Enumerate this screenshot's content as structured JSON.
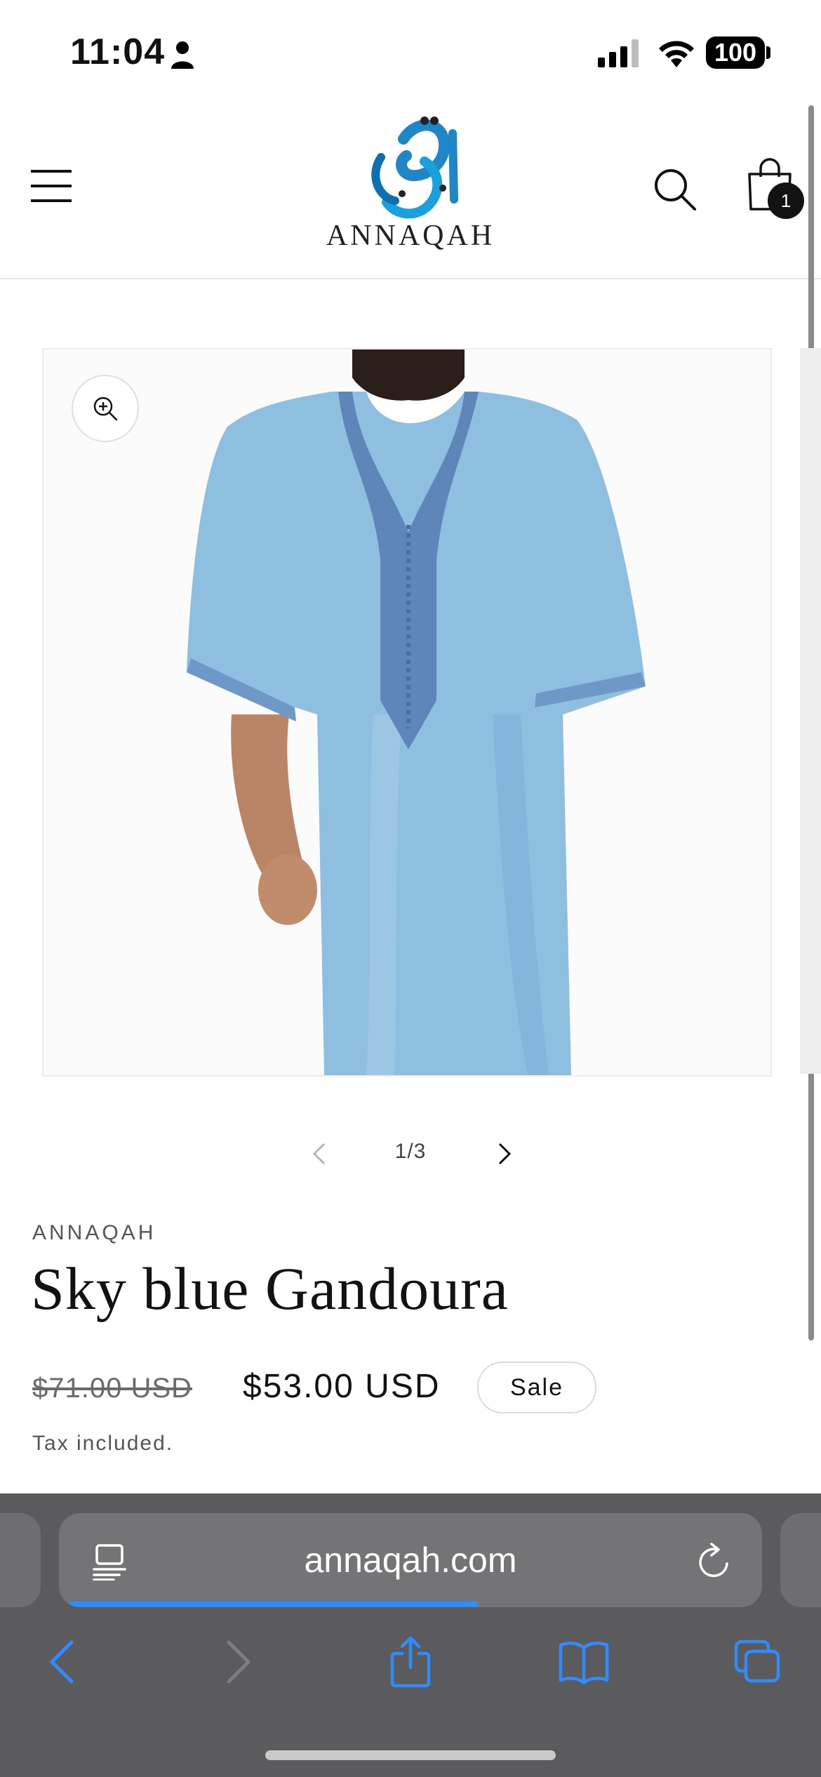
{
  "status_bar": {
    "time": "11:04",
    "battery": "100"
  },
  "header": {
    "logo_text": "ANNAQAH",
    "cart_count": "1"
  },
  "gallery": {
    "counter": "1/3",
    "current_slide": 1,
    "total_slides": 3
  },
  "product": {
    "vendor": "ANNAQAH",
    "title": "Sky blue Gandoura",
    "compare_price": "$71.00 USD",
    "price": "$53.00 USD",
    "badge": "Sale",
    "tax_note": "Tax included."
  },
  "browser": {
    "url": "annaqah.com",
    "load_progress": 0.6
  },
  "colors": {
    "accent_blue": "#2f8cff",
    "robe_blue": "#8fbfe0",
    "embroidery_blue": "#5f86b8",
    "browser_bar": "#5b5b5d"
  }
}
